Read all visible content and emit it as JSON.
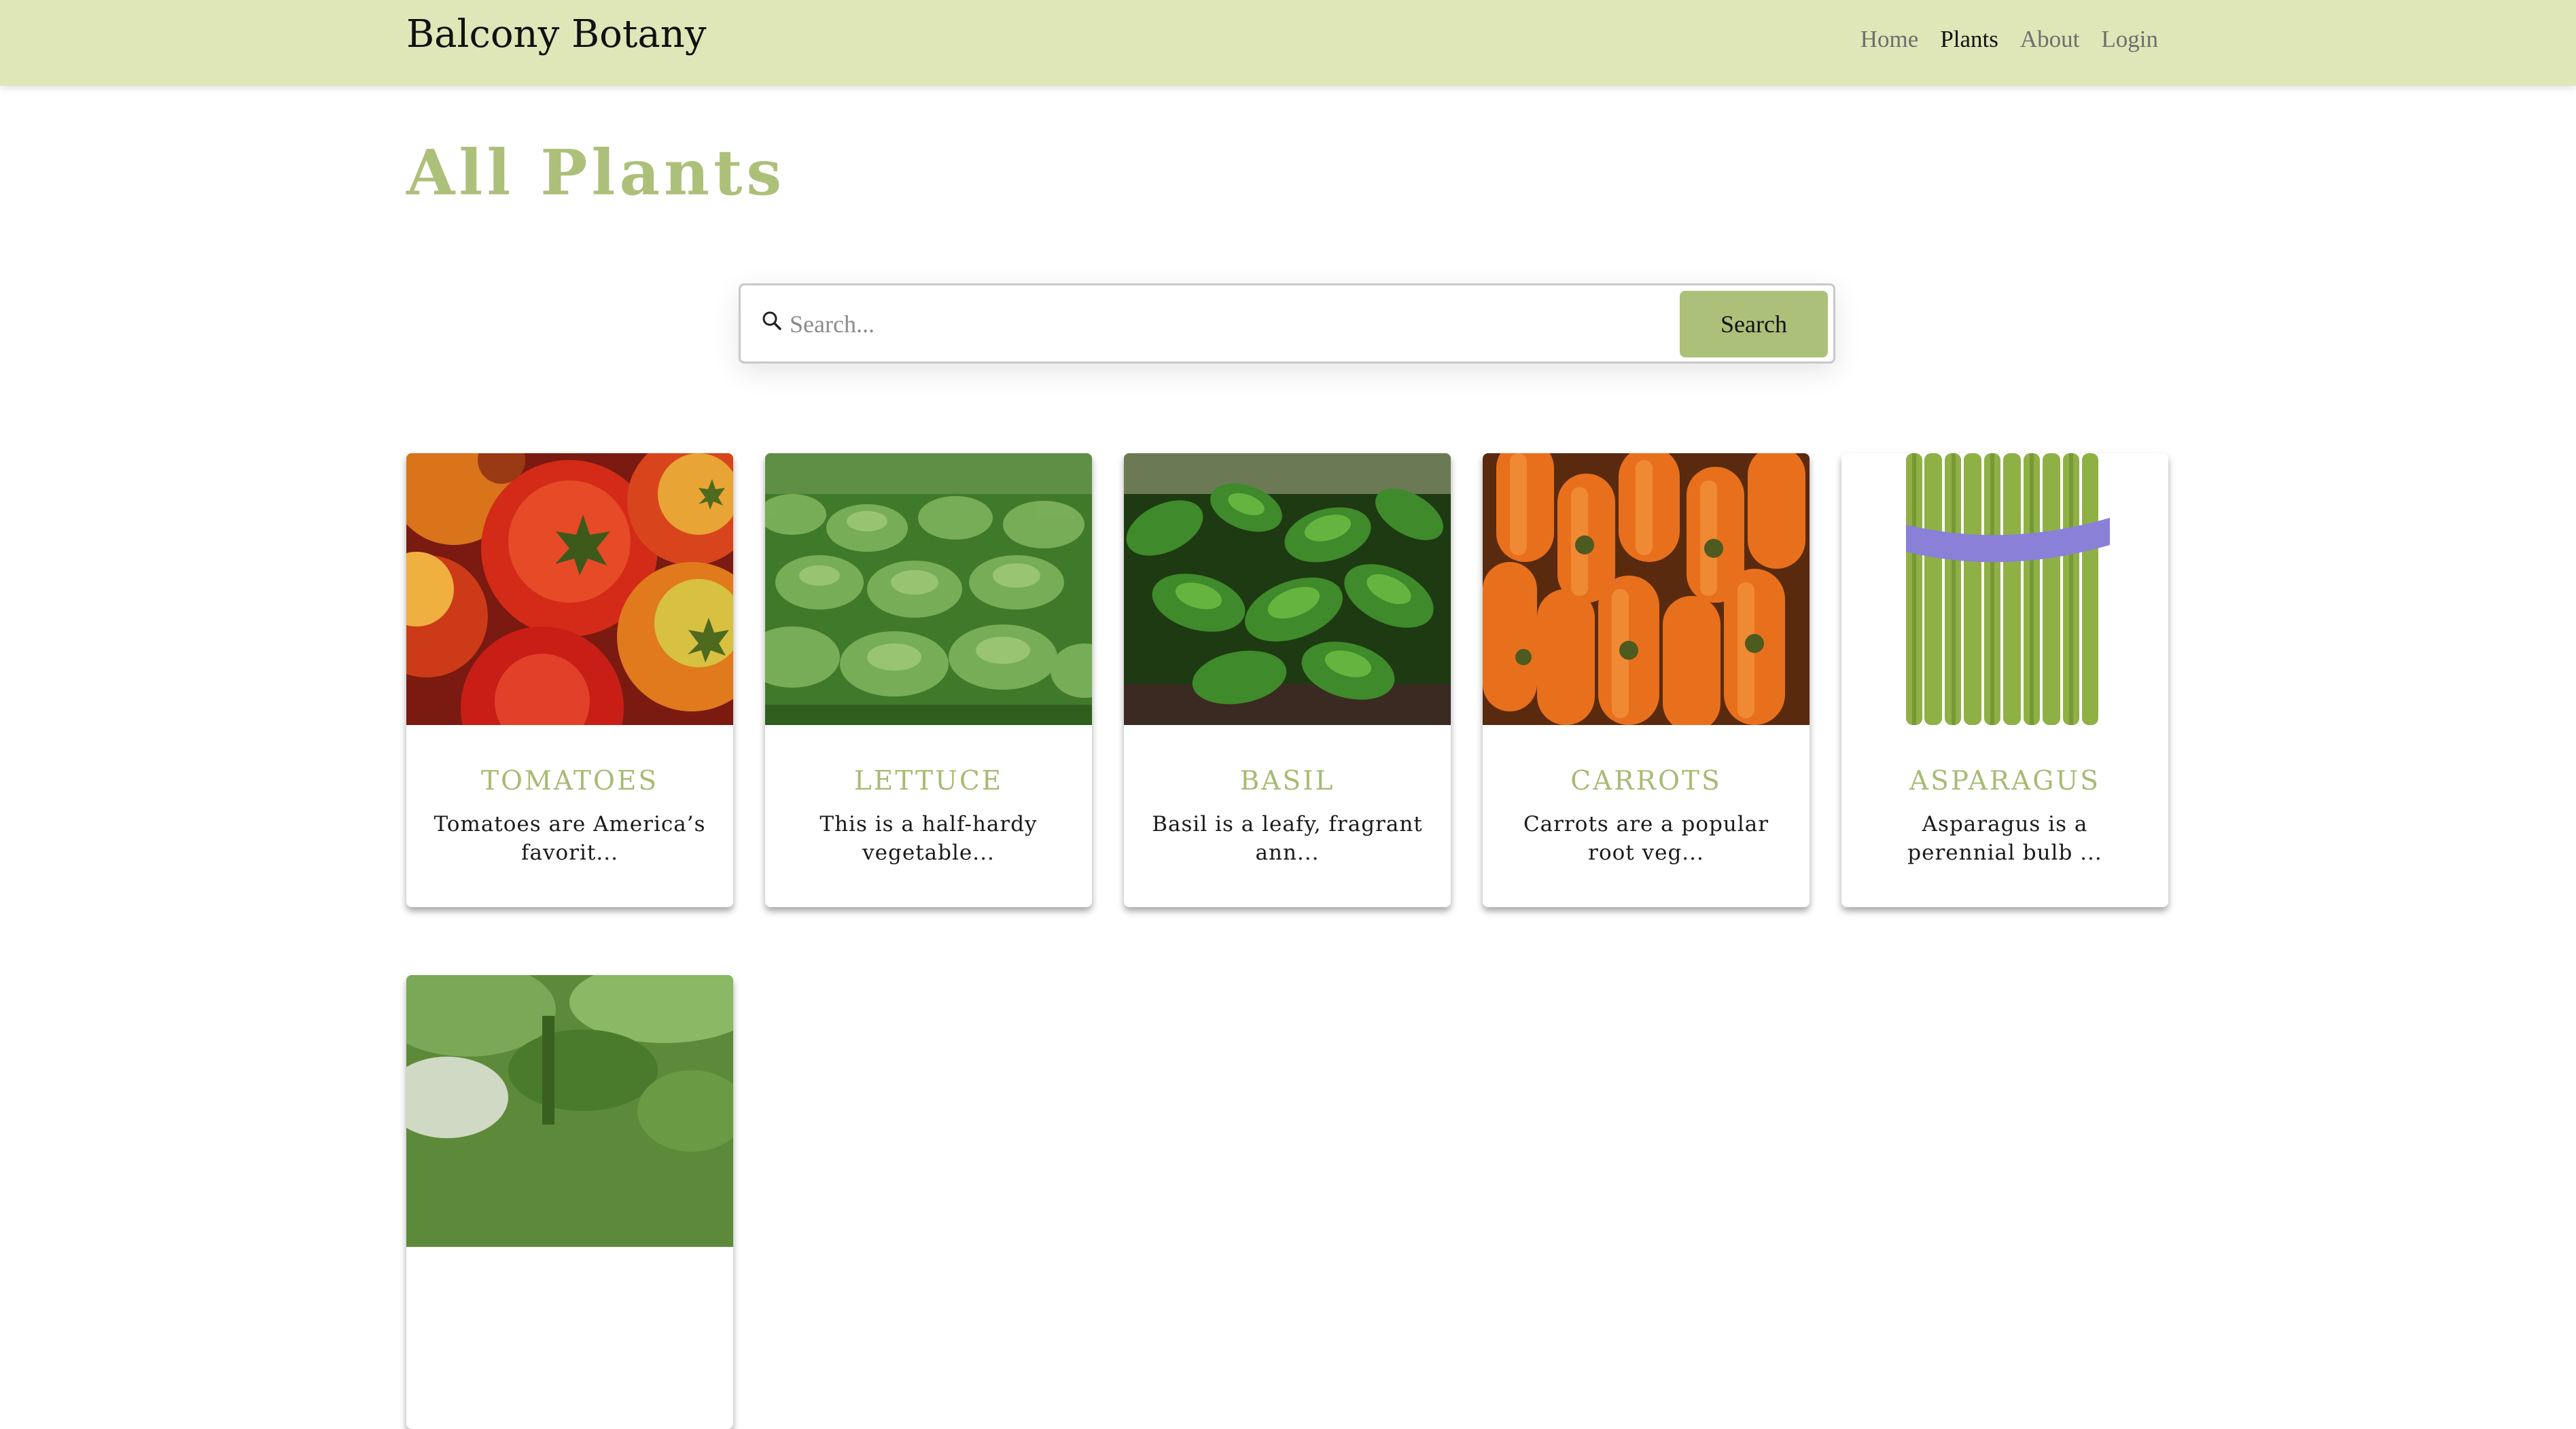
{
  "navbar": {
    "brand": "Balcony Botany",
    "links": [
      {
        "label": "Home",
        "active": false
      },
      {
        "label": "Plants",
        "active": true
      },
      {
        "label": "About",
        "active": false
      },
      {
        "label": "Login",
        "active": false
      }
    ]
  },
  "page": {
    "title": "All Plants"
  },
  "search": {
    "placeholder": "Search...",
    "value": "",
    "button_label": "Search",
    "icon": "search-icon"
  },
  "colors": {
    "navbar_bg": "#dfe6b8",
    "accent": "#adc07a",
    "card_title": "#a7bb73"
  },
  "plants": [
    {
      "name": "TOMATOES",
      "description": "Tomatoes are America’s favorit...",
      "image": "tomatoes-photo"
    },
    {
      "name": "LETTUCE",
      "description": "This is a half-hardy vegetable...",
      "image": "lettuce-photo"
    },
    {
      "name": "BASIL",
      "description": "Basil is a leafy, fragrant ann...",
      "image": "basil-photo"
    },
    {
      "name": "CARROTS",
      "description": "Carrots are a popular root veg...",
      "image": "carrots-photo"
    },
    {
      "name": "ASPARAGUS",
      "description": "Asparagus is a perennial bulb ...",
      "image": "asparagus-photo"
    },
    {
      "name": "",
      "description": "",
      "image": "beans-photo"
    }
  ]
}
